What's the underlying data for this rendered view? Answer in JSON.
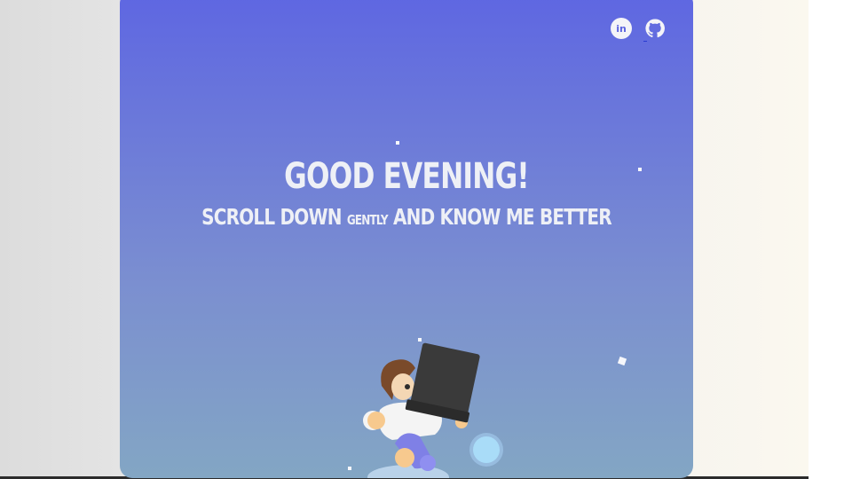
{
  "hero": {
    "title": "GOOD EVENING!",
    "subtitle_part1": "SCROLL DOWN",
    "subtitle_small": "GENTLY",
    "subtitle_part2": "AND KNOW ME BETTER"
  },
  "social": {
    "linkedin_icon": "linkedin-icon",
    "linkedin_text": "in",
    "github_icon": "github-icon"
  },
  "colors": {
    "gradient_top": "#5e66e2",
    "gradient_bottom": "#83a6c4",
    "text": "#eef0f6"
  }
}
